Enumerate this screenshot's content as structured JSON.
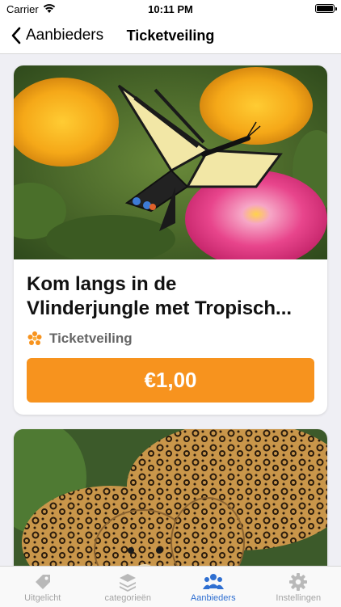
{
  "status_bar": {
    "carrier": "Carrier",
    "time": "10:11 PM"
  },
  "navbar": {
    "back_label": "Aanbieders",
    "title": "Ticketveiling"
  },
  "cards": [
    {
      "image": "butterfly-on-flower",
      "title_line1": "Kom langs in de",
      "title_line2": "Vlinderjungle met Tropisch...",
      "provider": "Ticketveiling",
      "price": "€1,00"
    },
    {
      "image": "leopards"
    }
  ],
  "tabs": [
    {
      "label": "Uitgelicht",
      "icon": "tag-icon",
      "active": false
    },
    {
      "label": "categorieën",
      "icon": "layers-icon",
      "active": false
    },
    {
      "label": "Aanbieders",
      "icon": "people-icon",
      "active": true
    },
    {
      "label": "Instellingen",
      "icon": "gear-icon",
      "active": false
    }
  ],
  "colors": {
    "accent": "#f7931e",
    "tab_active": "#2f6fd1",
    "tab_inactive": "#a4a4a4"
  }
}
